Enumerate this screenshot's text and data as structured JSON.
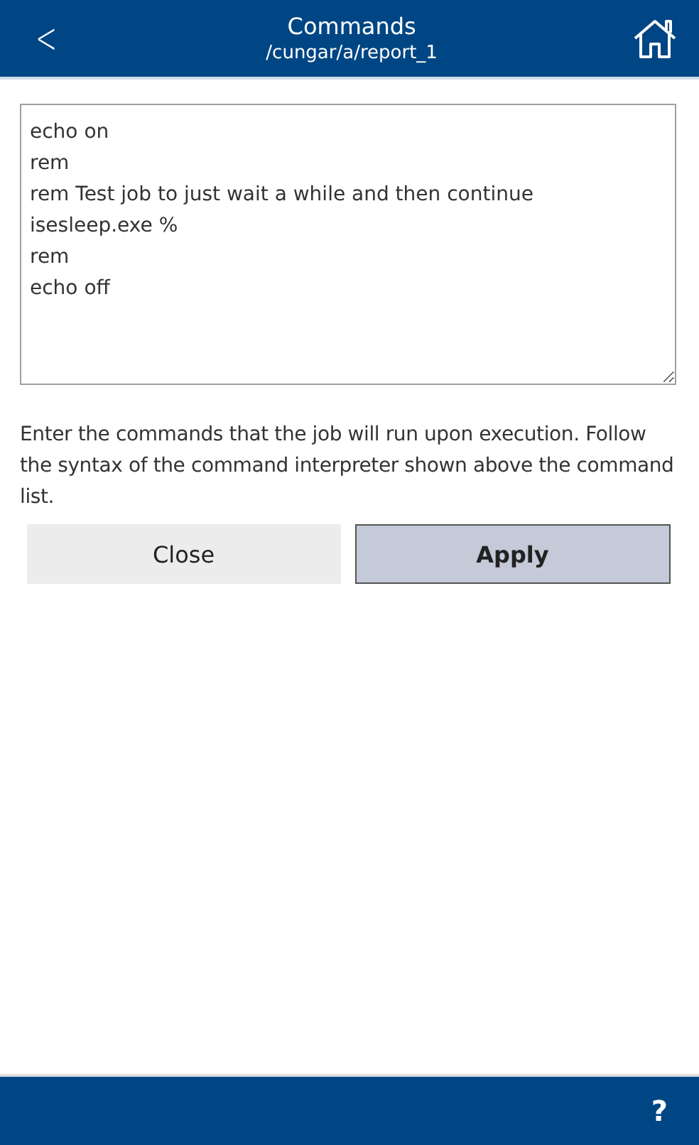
{
  "header": {
    "title": "Commands",
    "subtitle": "/cungar/a/report_1",
    "back": "<"
  },
  "commands": {
    "lines": [
      "echo on",
      "rem",
      "rem Test job to just wait a while and then continue",
      "isesleep.exe %",
      "rem",
      "echo off"
    ]
  },
  "description": "Enter the commands that the job will run upon execution. Follow the syntax of the command interpreter shown above the command list.",
  "buttons": [
    {
      "label": "Close",
      "kind": "secondary"
    },
    {
      "label": "Apply",
      "kind": "primary"
    }
  ],
  "footer": {
    "help": "?"
  }
}
